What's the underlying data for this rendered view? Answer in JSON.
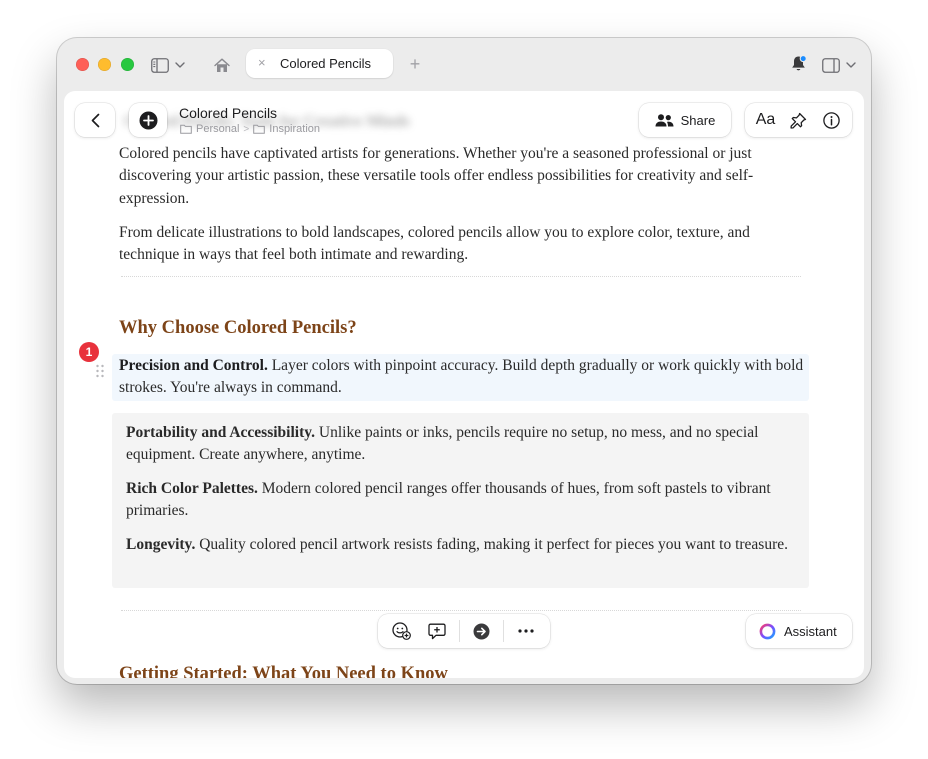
{
  "window": {
    "tab_title": "Colored Pencils",
    "tab_close": "×",
    "new_tab": "+"
  },
  "header": {
    "doc_title": "Colored Pencils",
    "breadcrumb": [
      "Personal",
      "Inspiration"
    ],
    "blurred_title": "Colored Pencils: Tools for Creative Minds",
    "share_label": "Share",
    "font_label": "Aa"
  },
  "content": {
    "intro_1": "Colored pencils have captivated artists for generations. Whether you're a seasoned professional or just discovering your artistic passion, these versatile tools offer endless possibilities for creativity and self-expression.",
    "intro_2": "From delicate illustrations to bold landscapes, colored pencils allow you to explore color, texture, and technique in ways that feel both intimate and rewarding.",
    "section_heading": "Why Choose Colored Pencils?",
    "badge_count": "1",
    "points": [
      {
        "title": "Precision and Control.",
        "text": " Layer colors with pinpoint accuracy. Build depth gradually or work quickly with bold strokes. You're always in command."
      },
      {
        "title": "Portability and Accessibility.",
        "text": " Unlike paints or inks, pencils require no setup, no mess, and no special equipment. Create anywhere, anytime."
      },
      {
        "title": "Rich Color Palettes.",
        "text": " Modern colored pencil ranges offer thousands of hues, from soft pastels to vibrant primaries."
      },
      {
        "title": "Longevity.",
        "text": " Quality colored pencil artwork resists fading, making it perfect for pieces you want to treasure."
      }
    ],
    "next_heading": "Getting Started: What You Need to Know"
  },
  "bottom": {
    "assistant_label": "Assistant"
  },
  "colors": {
    "heading": "#7d4418",
    "badge": "#e8323c",
    "highlight": "#f1f7fd",
    "quote_bg": "#f4f4f4"
  }
}
